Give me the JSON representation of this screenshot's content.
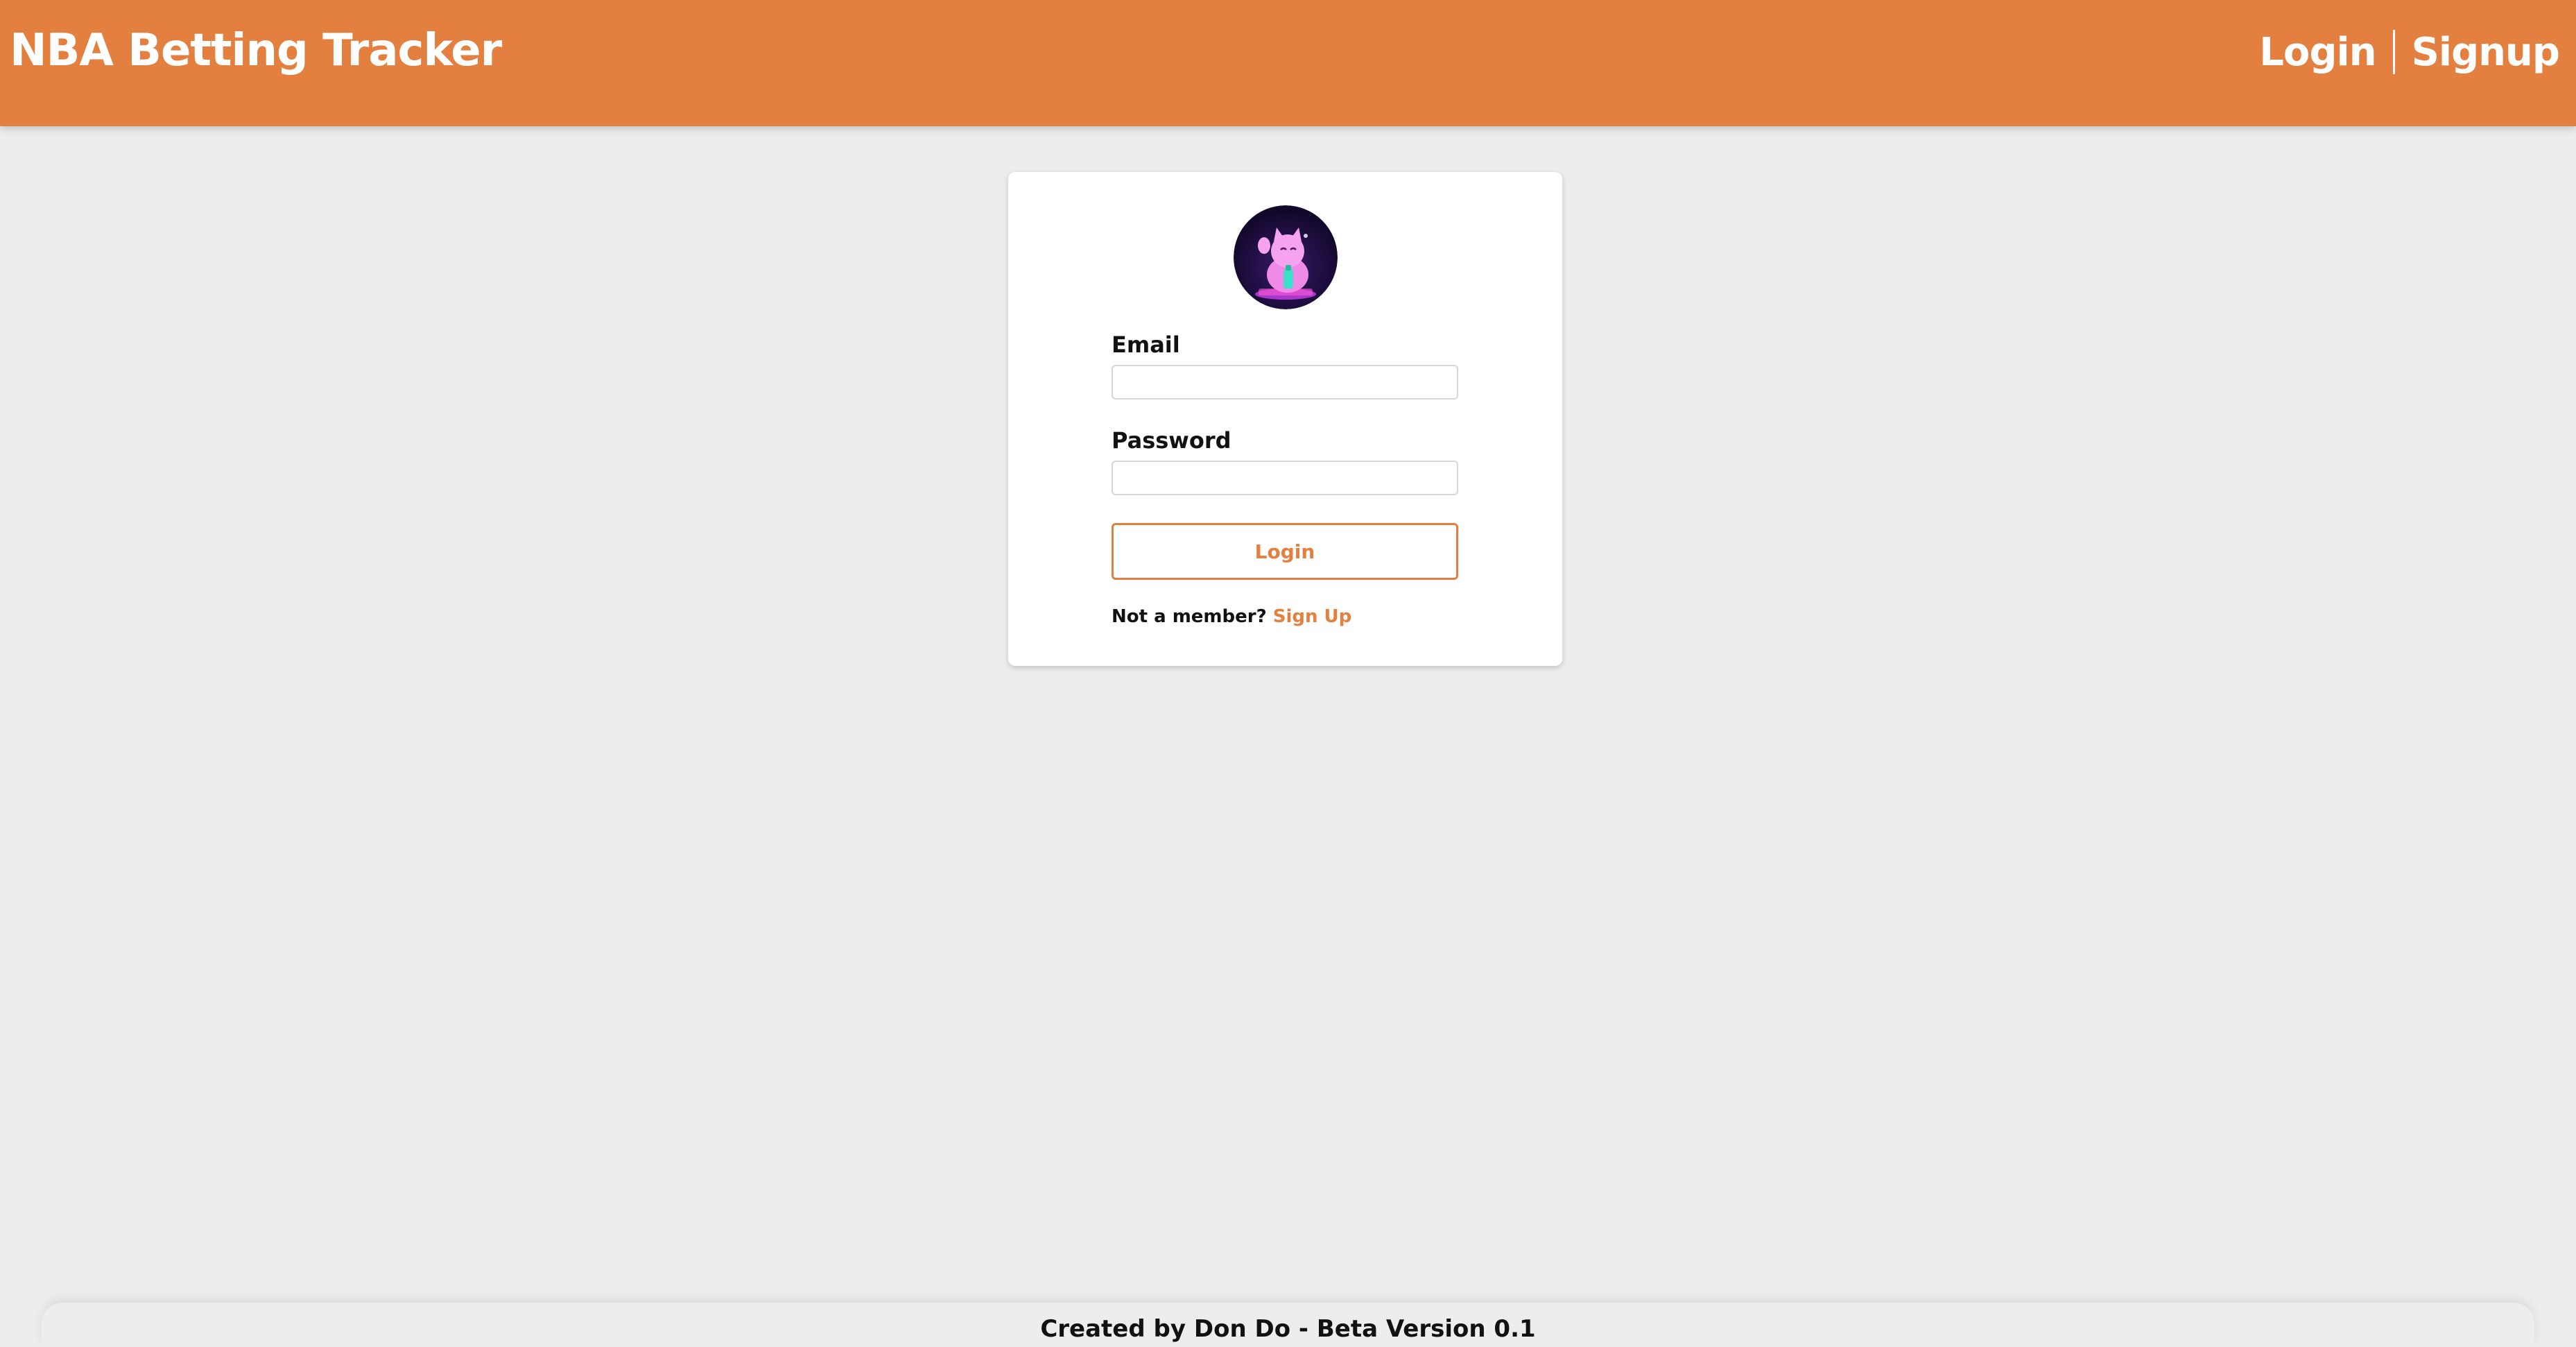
{
  "navbar": {
    "brand": "NBA Betting Tracker",
    "login_label": "Login",
    "signup_label": "Signup"
  },
  "colors": {
    "accent": "#e37f3f",
    "background": "#ededed",
    "card": "#ffffff",
    "avatar_bg": "#1c0f3a"
  },
  "login_form": {
    "avatar_icon": "lucky-cat-avatar-icon",
    "email_label": "Email",
    "email_value": "",
    "password_label": "Password",
    "password_value": "",
    "submit_label": "Login",
    "not_member_text": "Not a member?",
    "signup_link": "Sign Up"
  },
  "footer": {
    "text": "Created by Don Do - Beta Version 0.1"
  }
}
